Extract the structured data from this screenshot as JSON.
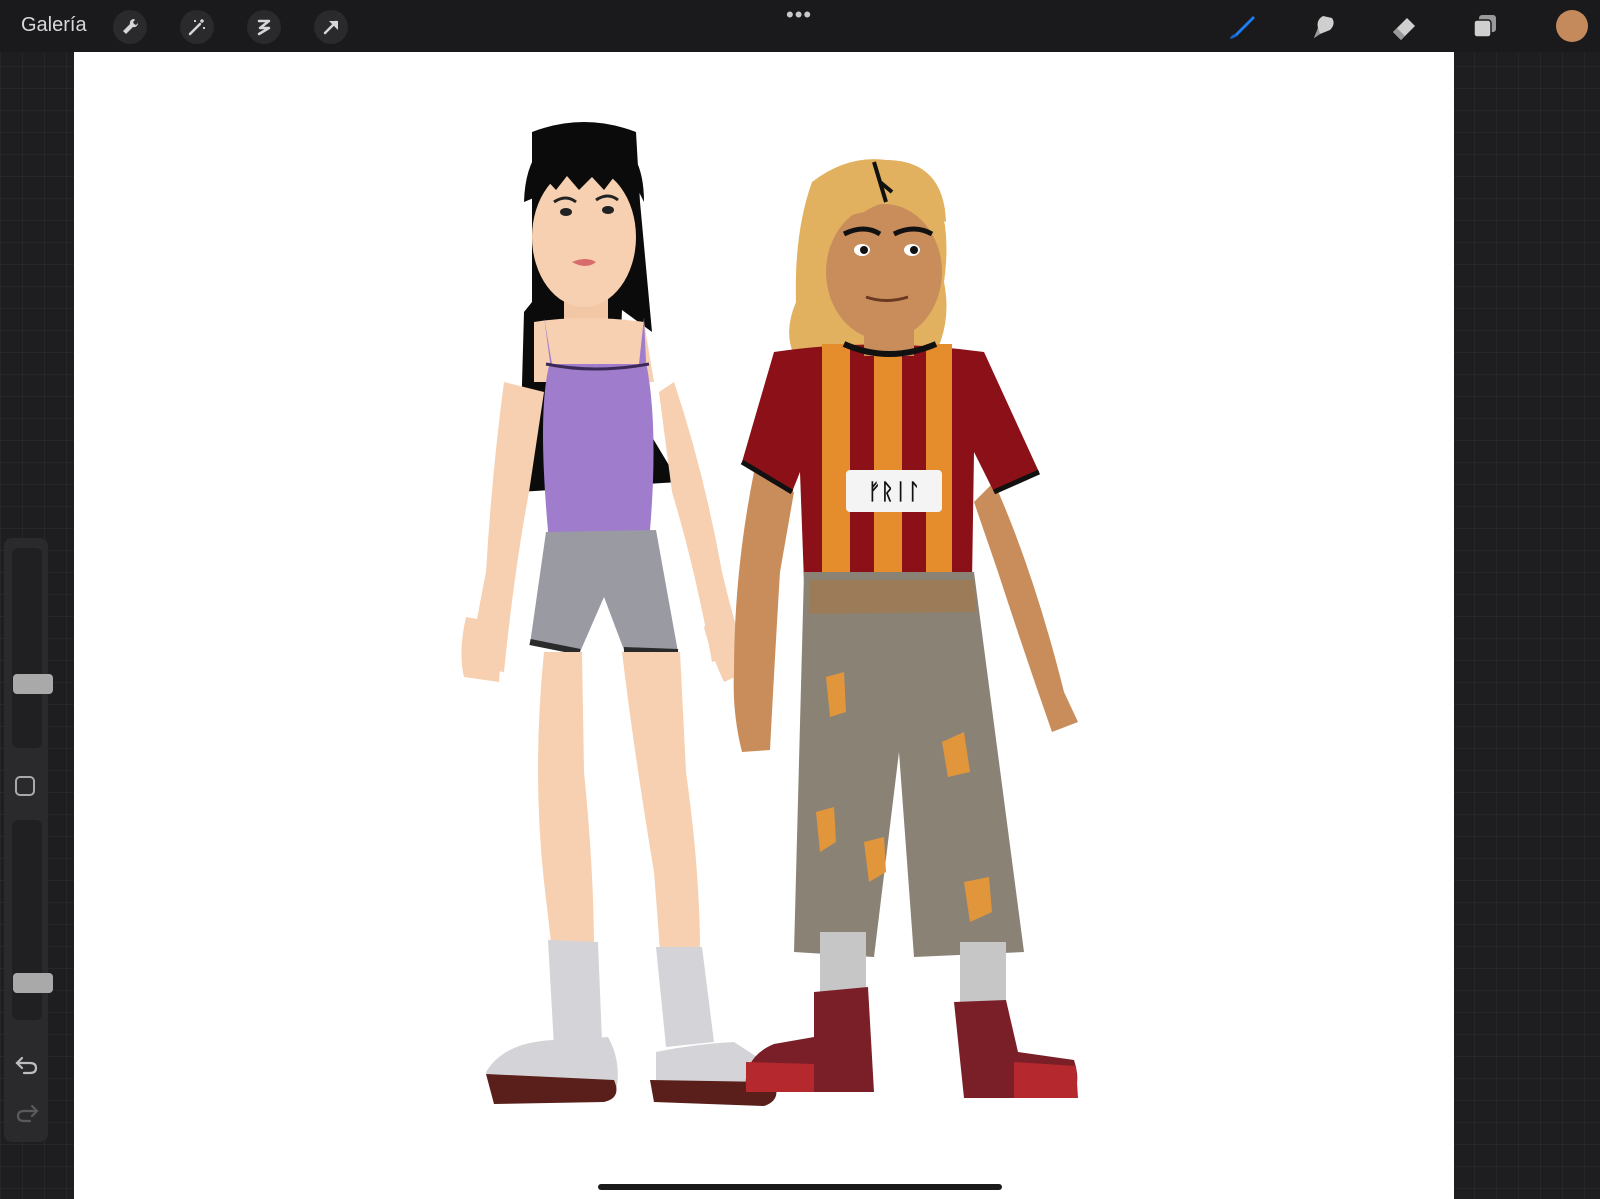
{
  "topbar": {
    "gallery_label": "Galería",
    "actions": [
      "wrench-icon",
      "magic-wand-icon",
      "selection-icon",
      "transform-arrow-icon"
    ],
    "more_label": "•••",
    "tools": [
      "brush-icon",
      "smudge-icon",
      "eraser-icon",
      "layers-icon"
    ],
    "current_color": "#c58a5b",
    "brush_accent": "#1e7cf2"
  },
  "sidebar": {
    "brush_size_level": 0.3,
    "opacity_level": 0.15,
    "controls": [
      "brush-size-slider",
      "modify-button",
      "opacity-slider",
      "undo-icon",
      "redo-icon"
    ]
  },
  "canvas": {
    "background": "#ffffff",
    "jersey_text": "ᚠᚱᛁᛚ"
  }
}
